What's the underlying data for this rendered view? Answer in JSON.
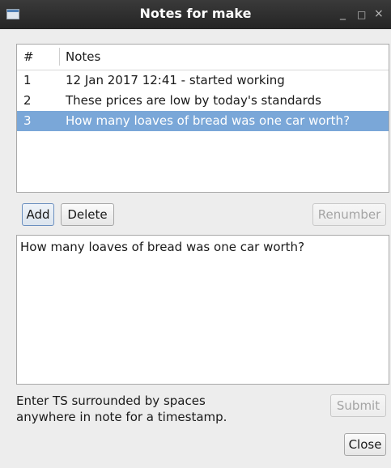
{
  "window": {
    "title": "Notes for make"
  },
  "list": {
    "headers": {
      "num": "#",
      "notes": "Notes"
    },
    "rows": [
      {
        "num": "1",
        "note": "12 Jan 2017 12:41 - started working",
        "selected": false
      },
      {
        "num": "2",
        "note": "These prices are low by today's standards",
        "selected": false
      },
      {
        "num": "3",
        "note": "How many loaves of bread was one car worth?",
        "selected": true
      }
    ]
  },
  "buttons": {
    "add": "Add",
    "delete": "Delete",
    "renumber": "Renumber",
    "submit": "Submit",
    "close": "Close"
  },
  "editor": {
    "value": "How many loaves of bread was one car worth?"
  },
  "hint": {
    "line1": "Enter TS surrounded by spaces",
    "line2": "anywhere in note for a timestamp."
  },
  "colors": {
    "selection": "#7aa7d8",
    "titlebar": "#2b2b2b"
  }
}
